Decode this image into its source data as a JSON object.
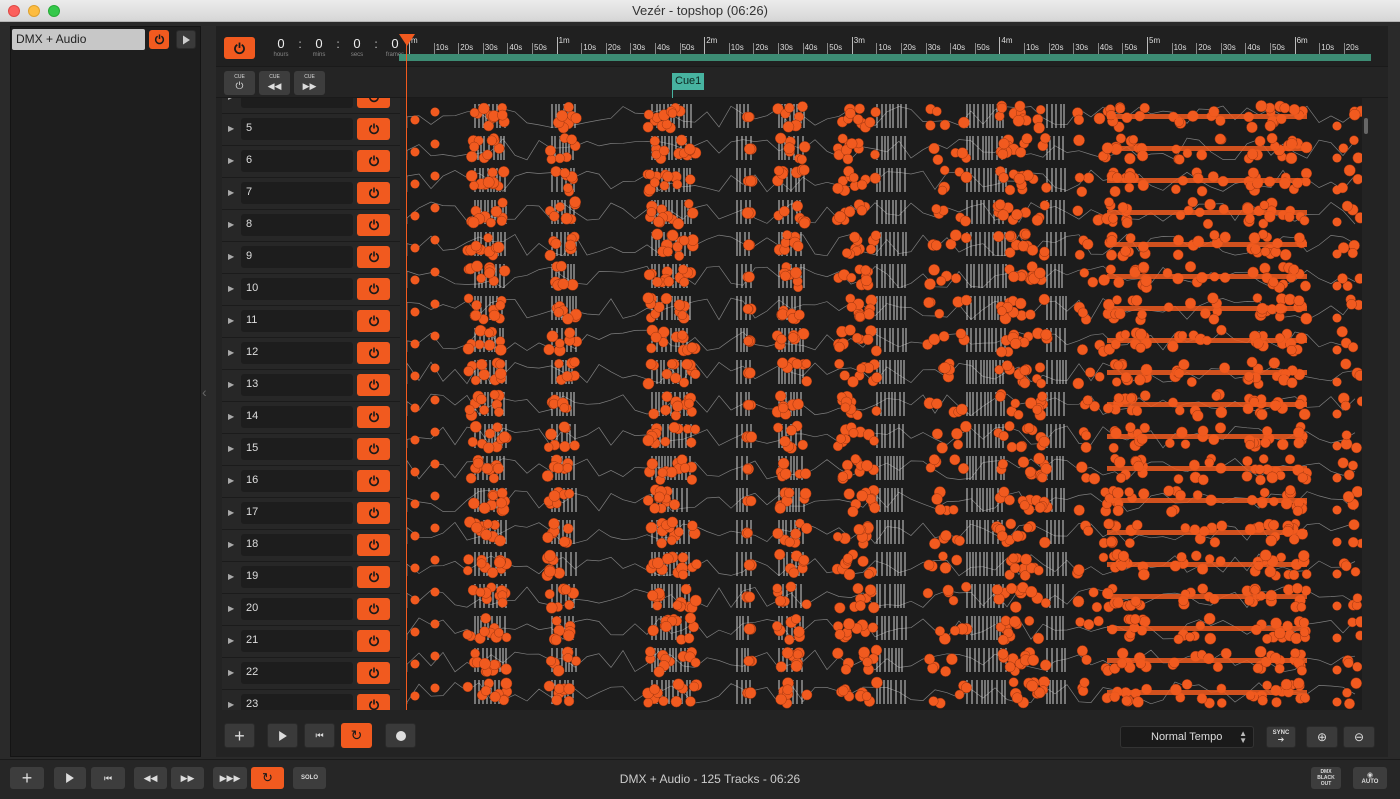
{
  "window": {
    "title": "Vezér - topshop (06:26)"
  },
  "project_list": {
    "items": [
      {
        "label": "DMX + Audio"
      }
    ]
  },
  "timecode": {
    "hours": "0",
    "mins": "0",
    "secs": "0",
    "frames": "0",
    "hours_label": "hours",
    "mins_label": "mins",
    "secs_label": "secs",
    "frames_label": "frames"
  },
  "ruler": {
    "ticks": [
      "m",
      "10s",
      "20s",
      "30s",
      "40s",
      "50s",
      "1m",
      "10s",
      "20s",
      "30s",
      "40s",
      "50s",
      "2m",
      "10s",
      "20s",
      "30s",
      "40s",
      "50s",
      "3m",
      "10s",
      "20s",
      "30s",
      "40s",
      "50s",
      "4m",
      "10s",
      "20s",
      "30s",
      "40s",
      "50s",
      "5m",
      "10s",
      "20s",
      "30s",
      "40s",
      "50s",
      "6m",
      "10s",
      "20s"
    ]
  },
  "cue_buttons": [
    {
      "label": "CUE"
    },
    {
      "label": "CUE"
    },
    {
      "label": "CUE"
    }
  ],
  "cue_marker": {
    "label": "Cue1"
  },
  "tracks": [
    "",
    "5",
    "6",
    "7",
    "8",
    "9",
    "10",
    "11",
    "12",
    "13",
    "14",
    "15",
    "16",
    "17",
    "18",
    "19",
    "20",
    "21",
    "22",
    "23"
  ],
  "toolbar": {
    "tempo": "Normal Tempo",
    "sync_label": "SYNC"
  },
  "status": {
    "text": "DMX + Audio - 125 Tracks - 06:26",
    "solo_label": "SOLO",
    "blackout_label": "DMX BLACK OUT",
    "auto_label": "AUTO"
  },
  "colors": {
    "accent": "#f15a1f",
    "cue": "#47b3a0",
    "keyframe": "#f15a1f",
    "curve": "#d0d0d0"
  }
}
